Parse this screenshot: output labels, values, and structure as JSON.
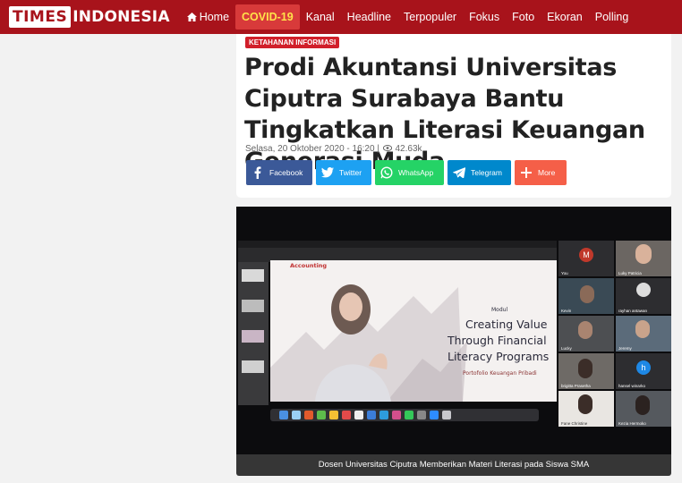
{
  "brand": {
    "part1": "TIMES",
    "part2": "INDONESIA"
  },
  "nav": [
    {
      "label": "Home",
      "icon": "home-icon"
    },
    {
      "label": "COVID-19",
      "active": true
    },
    {
      "label": "Kanal"
    },
    {
      "label": "Headline"
    },
    {
      "label": "Terpopuler"
    },
    {
      "label": "Fokus"
    },
    {
      "label": "Foto"
    },
    {
      "label": "Ekoran"
    },
    {
      "label": "Polling"
    }
  ],
  "article": {
    "category": "KETAHANAN INFORMASI",
    "title": "Prodi Akuntansi Universitas Ciputra Surabaya Bantu Tingkatkan Literasi Keuangan Generasi Muda",
    "date": "Selasa, 20 Oktober 2020 - 16:20 |",
    "views": "42.63k"
  },
  "share": [
    {
      "label": "Facebook",
      "icon": "facebook-icon",
      "color": "#3b5998"
    },
    {
      "label": "Twitter",
      "icon": "twitter-icon",
      "color": "#1da1f2"
    },
    {
      "label": "WhatsApp",
      "icon": "whatsapp-icon",
      "color": "#25d366"
    },
    {
      "label": "Telegram",
      "icon": "telegram-icon",
      "color": "#0088cc"
    },
    {
      "label": "More",
      "icon": "plus-icon",
      "color": "#f55f48"
    }
  ],
  "photo": {
    "slide": {
      "tag": "Accounting",
      "module": "Modul",
      "line1": "Creating Value",
      "line2": "Through Financial",
      "line3": "Literacy Programs",
      "subtitle": "Portofolio Keuangan Pribadi"
    },
    "participants": [
      "You",
      "Luky Patricia",
      "Kevin",
      "rayhan antawan",
      "Lucky",
      "Jeremy",
      "brigitta Prasetha",
      "hansel winarko",
      "Fane Christine",
      "Kezia Hermoko"
    ],
    "caption": "Dosen Universitas Ciputra Memberikan Materi Literasi pada Siswa SMA"
  },
  "colors": {
    "brand_red": "#a8131b",
    "covid_highlight": "#ffe24a",
    "tag_red": "#d11f2a"
  }
}
